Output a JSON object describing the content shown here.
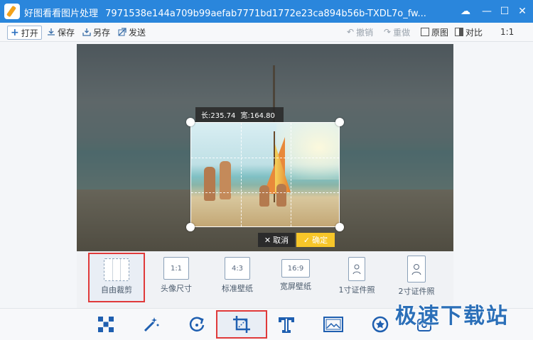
{
  "window": {
    "app_name": "好图看看图片处理",
    "file_name": "7971538e144a709b99aefab7771bd1772e23ca894b56b-TXDL7o_fw...",
    "controls": {
      "cloud": "☁",
      "minimize": "—",
      "maximize": "☐",
      "close": "✕"
    }
  },
  "toolbar": {
    "open": "打开",
    "save": "保存",
    "save_as": "另存",
    "send": "发送",
    "undo": "撤销",
    "redo": "重做",
    "original": "原图",
    "compare": "对比",
    "ratio": "1:1"
  },
  "crop": {
    "length_label": "长:235.74",
    "width_label": "宽:164.80",
    "cancel": "取消",
    "confirm": "确定"
  },
  "presets": [
    {
      "id": "free",
      "label": "自由裁剪",
      "glyph": "",
      "active": true
    },
    {
      "id": "avatar",
      "label": "头像尺寸",
      "glyph": "1:1",
      "active": false
    },
    {
      "id": "standard",
      "label": "标准壁纸",
      "glyph": "4:3",
      "active": false
    },
    {
      "id": "wide",
      "label": "宽屏壁纸",
      "glyph": "16:9",
      "active": false
    },
    {
      "id": "photo1",
      "label": "1寸证件照",
      "glyph": "",
      "active": false
    },
    {
      "id": "photo2",
      "label": "2寸证件照",
      "glyph": "",
      "active": false
    }
  ],
  "bottom_tools": [
    {
      "id": "mosaic-icon",
      "active": false
    },
    {
      "id": "magic-wand-icon",
      "active": false
    },
    {
      "id": "rotate-icon",
      "active": false
    },
    {
      "id": "crop-icon",
      "active": true
    },
    {
      "id": "text-icon",
      "active": false
    },
    {
      "id": "frame-icon",
      "active": false
    },
    {
      "id": "sticker-icon",
      "active": false
    },
    {
      "id": "more-icon",
      "active": false
    }
  ],
  "watermark": "极速下载站",
  "colors": {
    "titlebar": "#2a86dc",
    "confirm": "#f7c629",
    "highlight": "#e03a3a"
  }
}
